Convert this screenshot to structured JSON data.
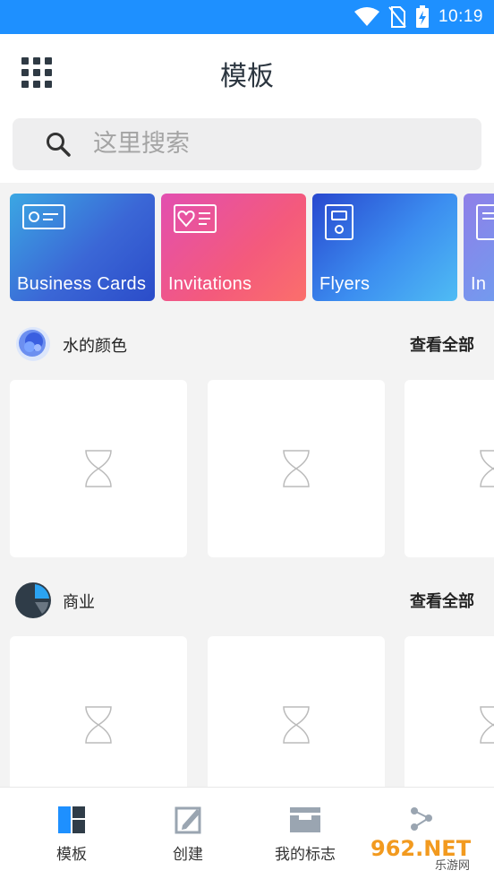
{
  "status_bar": {
    "time": "10:19"
  },
  "header": {
    "title": "模板"
  },
  "search": {
    "placeholder": "这里搜索"
  },
  "categories": [
    {
      "label": "Business Cards",
      "icon": "id-card-icon"
    },
    {
      "label": "Invitations",
      "icon": "heart-card-icon"
    },
    {
      "label": "Flyers",
      "icon": "flyer-icon"
    },
    {
      "label": "In",
      "icon": "document-icon"
    }
  ],
  "sections": [
    {
      "title": "水的颜色",
      "see_all": "查看全部",
      "icon": "watercolor-icon"
    },
    {
      "title": "商业",
      "see_all": "查看全部",
      "icon": "pie-chart-icon"
    }
  ],
  "bottom_nav": [
    {
      "label": "模板",
      "icon": "templates-icon",
      "active": true
    },
    {
      "label": "创建",
      "icon": "create-icon"
    },
    {
      "label": "我的标志",
      "icon": "my-logos-icon"
    },
    {
      "label": "",
      "icon": "share-icon"
    }
  ],
  "watermark": {
    "brand": "962.NET",
    "sub": "乐游网"
  },
  "colors": {
    "status_bar": "#1e90ff",
    "accent": "#1e90ff",
    "text": "#2c3640"
  }
}
